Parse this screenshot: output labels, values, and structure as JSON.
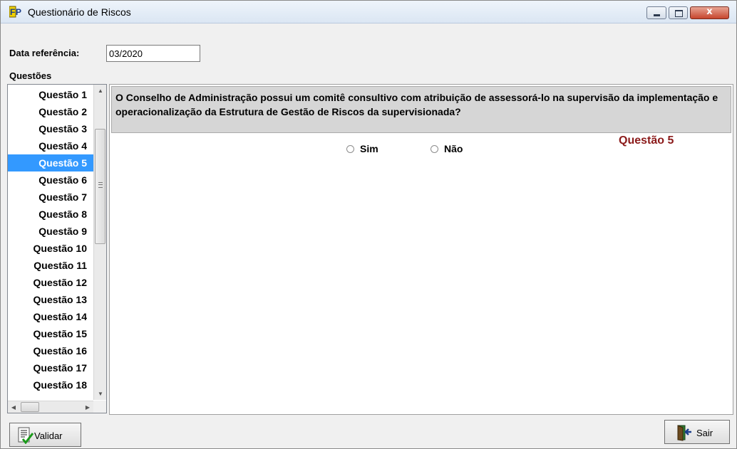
{
  "window": {
    "title": "Questionário de Riscos",
    "close_symbol": "x"
  },
  "form": {
    "date_label": "Data referência:",
    "date_value": "03/2020",
    "questions_label": "Questões"
  },
  "questions": {
    "items": [
      "Questão 1",
      "Questão 2",
      "Questão 3",
      "Questão 4",
      "Questão 5",
      "Questão 6",
      "Questão 7",
      "Questão 8",
      "Questão 9",
      "Questão 10",
      "Questão 11",
      "Questão 12",
      "Questão 13",
      "Questão 14",
      "Questão 15",
      "Questão 16",
      "Questão 17",
      "Questão 18"
    ],
    "selected_index": 4
  },
  "current_question": {
    "text": "O Conselho de Administração possui um comitê consultivo com atribuição de assessorá-lo na supervisão da implementação e operacionalização da Estrutura de Gestão de Riscos da supervisionada?",
    "number_label": "Questão 5",
    "options": {
      "yes": "Sim",
      "no": "Não"
    }
  },
  "buttons": {
    "validate": "Validar",
    "exit": "Sair"
  },
  "colors": {
    "selection": "#3399ff",
    "question_number": "#8b1a1a",
    "question_background": "#d6d6d6"
  },
  "icons": [
    "app-logo-icon",
    "minimize-icon",
    "maximize-icon",
    "close-icon",
    "scroll-up-icon",
    "scroll-down-icon",
    "scroll-left-icon",
    "scroll-right-icon",
    "checklist-icon",
    "exit-door-icon"
  ]
}
